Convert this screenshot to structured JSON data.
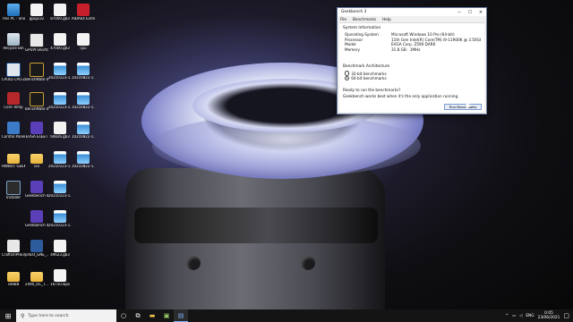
{
  "desktop_icons": [
    {
      "label": "This PC - Shortcut",
      "icon": "this-pc-icon",
      "cls": "ic-pc"
    },
    {
      "label": "gpupi32",
      "icon": "file-icon",
      "cls": "ic-file"
    },
    {
      "label": "87000.gb3",
      "icon": "file-icon",
      "cls": "ic-file"
    },
    {
      "label": "AIDA64 Extreme",
      "icon": "aida64-icon",
      "cls": "ic-aida"
    },
    {
      "label": "Recycle Bin",
      "icon": "recycle-bin-icon",
      "cls": "ic-bin"
    },
    {
      "label": "GPUPI Shortcut",
      "icon": "gpupi-icon",
      "cls": "ic-gpuz"
    },
    {
      "label": "47000.gb3",
      "icon": "file-icon",
      "cls": "ic-file"
    },
    {
      "label": "cpu",
      "icon": "file-icon",
      "cls": "ic-file"
    },
    {
      "label": "CPUID CPU-Z",
      "icon": "cpuz-icon",
      "cls": "ic-cpuz"
    },
    {
      "label": "BenchMate 0.10.4",
      "icon": "benchmate-icon",
      "cls": "ic-bench"
    },
    {
      "label": "20210123-1...",
      "icon": "image-icon",
      "cls": "ic-img"
    },
    {
      "label": "10210822-1...",
      "icon": "image-icon",
      "cls": "ic-img"
    },
    {
      "label": "Core Temp",
      "icon": "core-temp-icon",
      "cls": "ic-temp"
    },
    {
      "label": "BenchMate 0.10.4 (H...",
      "icon": "benchmate-icon",
      "cls": "ic-bench"
    },
    {
      "label": "20210123-1...",
      "icon": "image-icon",
      "cls": "ic-img"
    },
    {
      "label": "10210822-1...",
      "icon": "image-icon",
      "cls": "ic-img"
    },
    {
      "label": "Control Panel",
      "icon": "control-panel-icon",
      "cls": "ic-ctrl"
    },
    {
      "label": "EVGA ELEET",
      "icon": "geekbench-icon",
      "cls": "ic-gb"
    },
    {
      "label": "60826.gb3",
      "icon": "file-icon",
      "cls": "ic-file"
    },
    {
      "label": "10210822-1...",
      "icon": "image-icon",
      "cls": "ic-img"
    },
    {
      "label": "HWBOT GEEK...",
      "icon": "folder-icon",
      "cls": "ic-folder"
    },
    {
      "label": "ivo",
      "icon": "folder-icon",
      "cls": "ic-folder"
    },
    {
      "label": "20210123-1...",
      "icon": "image-icon",
      "cls": "ic-img"
    },
    {
      "label": "10210822-1...",
      "icon": "image-icon",
      "cls": "ic-img"
    },
    {
      "label": "Installer",
      "icon": "graphics-card-icon",
      "cls": "ic-card"
    },
    {
      "label": "Geekbench 4",
      "icon": "geekbench-icon",
      "cls": "ic-gb"
    },
    {
      "label": "20210123-1...",
      "icon": "image-icon",
      "cls": "ic-img"
    },
    {
      "label": "",
      "icon": "",
      "cls": ""
    },
    {
      "label": "",
      "icon": "",
      "cls": ""
    },
    {
      "label": "Geekbench 4",
      "icon": "geekbench-icon",
      "cls": "ic-gb"
    },
    {
      "label": "20210123-1...",
      "icon": "image-icon",
      "cls": "ic-img"
    },
    {
      "label": "",
      "icon": "",
      "cls": ""
    },
    {
      "label": "CraftsmPREV...",
      "icon": "craftsm-icon",
      "cls": "ic-paint"
    },
    {
      "label": "pifast_GNE_... Shortcut",
      "icon": "shortcut-icon",
      "cls": "ic-sc"
    },
    {
      "label": "49623.gb3",
      "icon": "file-icon",
      "cls": "ic-file"
    },
    {
      "label": "",
      "icon": "",
      "cls": ""
    },
    {
      "label": "s4688",
      "icon": "folder-icon",
      "cls": "ic-folder"
    },
    {
      "label": "2490_OC_T...",
      "icon": "folder-icon",
      "cls": "ic-folder"
    },
    {
      "label": "16750.wps",
      "icon": "file-icon",
      "cls": "ic-file"
    },
    {
      "label": "",
      "icon": "",
      "cls": ""
    }
  ],
  "window": {
    "title": "Geekbench 3",
    "minimize": "─",
    "maximize": "☐",
    "close": "✕",
    "menu": [
      "File",
      "Benchmarks",
      "Help"
    ],
    "sysinfo_heading": "System Information",
    "sysinfo": [
      {
        "key": "Operating System",
        "value": "Microsoft Windows 10 Pro (64-bit)"
      },
      {
        "key": "Processor",
        "value": "11th Gen Intel(R) Core(TM) i9-11900K @ 3.50GHz @ 3.50"
      },
      {
        "key": "Model",
        "value": "EVGA Corp. Z590 DARK"
      },
      {
        "key": "Memory",
        "value": "31.8 GB · 1MHz"
      }
    ],
    "arch_heading": "Benchmark Architecture",
    "arch_options": [
      {
        "label": "32-bit benchmarks",
        "selected": false
      },
      {
        "label": "64-bit benchmarks",
        "selected": true
      }
    ],
    "ready_text": "Ready to run the benchmarks?",
    "note_text": "Geekbench works best when it's the only application running.",
    "run_button": "Run Benchmarks"
  },
  "taskbar": {
    "start_icon": "windows-icon",
    "search_placeholder": "Type here to search",
    "apps": [
      "cortana-icon",
      "task-view-icon",
      "file-explorer-icon",
      "taskbar-app-icon",
      "geekbench-taskbar-icon"
    ],
    "tray_language": "ENG",
    "time": "0:05",
    "date": "23/06/2021"
  },
  "colors": {
    "window_border": "#6b7fa3",
    "taskbar": "#141414",
    "frost": "#aeb2e0"
  }
}
